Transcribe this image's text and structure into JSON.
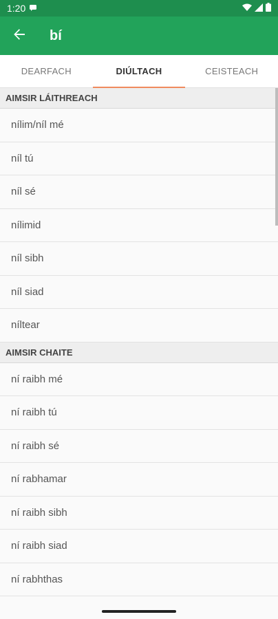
{
  "status": {
    "time": "1:20"
  },
  "appbar": {
    "title": "bí"
  },
  "tabs": [
    {
      "label": "DEARFACH"
    },
    {
      "label": "DIÚLTACH"
    },
    {
      "label": "CEISTEACH"
    }
  ],
  "sections": [
    {
      "header": "AIMSIR LÁITHREACH",
      "items": [
        "nílim/níl mé",
        "níl tú",
        "níl sé",
        "nílimid",
        "níl sibh",
        "níl siad",
        "níltear"
      ]
    },
    {
      "header": "AIMSIR CHAITE",
      "items": [
        "ní raibh mé",
        "ní raibh tú",
        "ní raibh sé",
        "ní rabhamar",
        "ní raibh sibh",
        "ní raibh siad",
        "ní rabhthas"
      ]
    }
  ]
}
